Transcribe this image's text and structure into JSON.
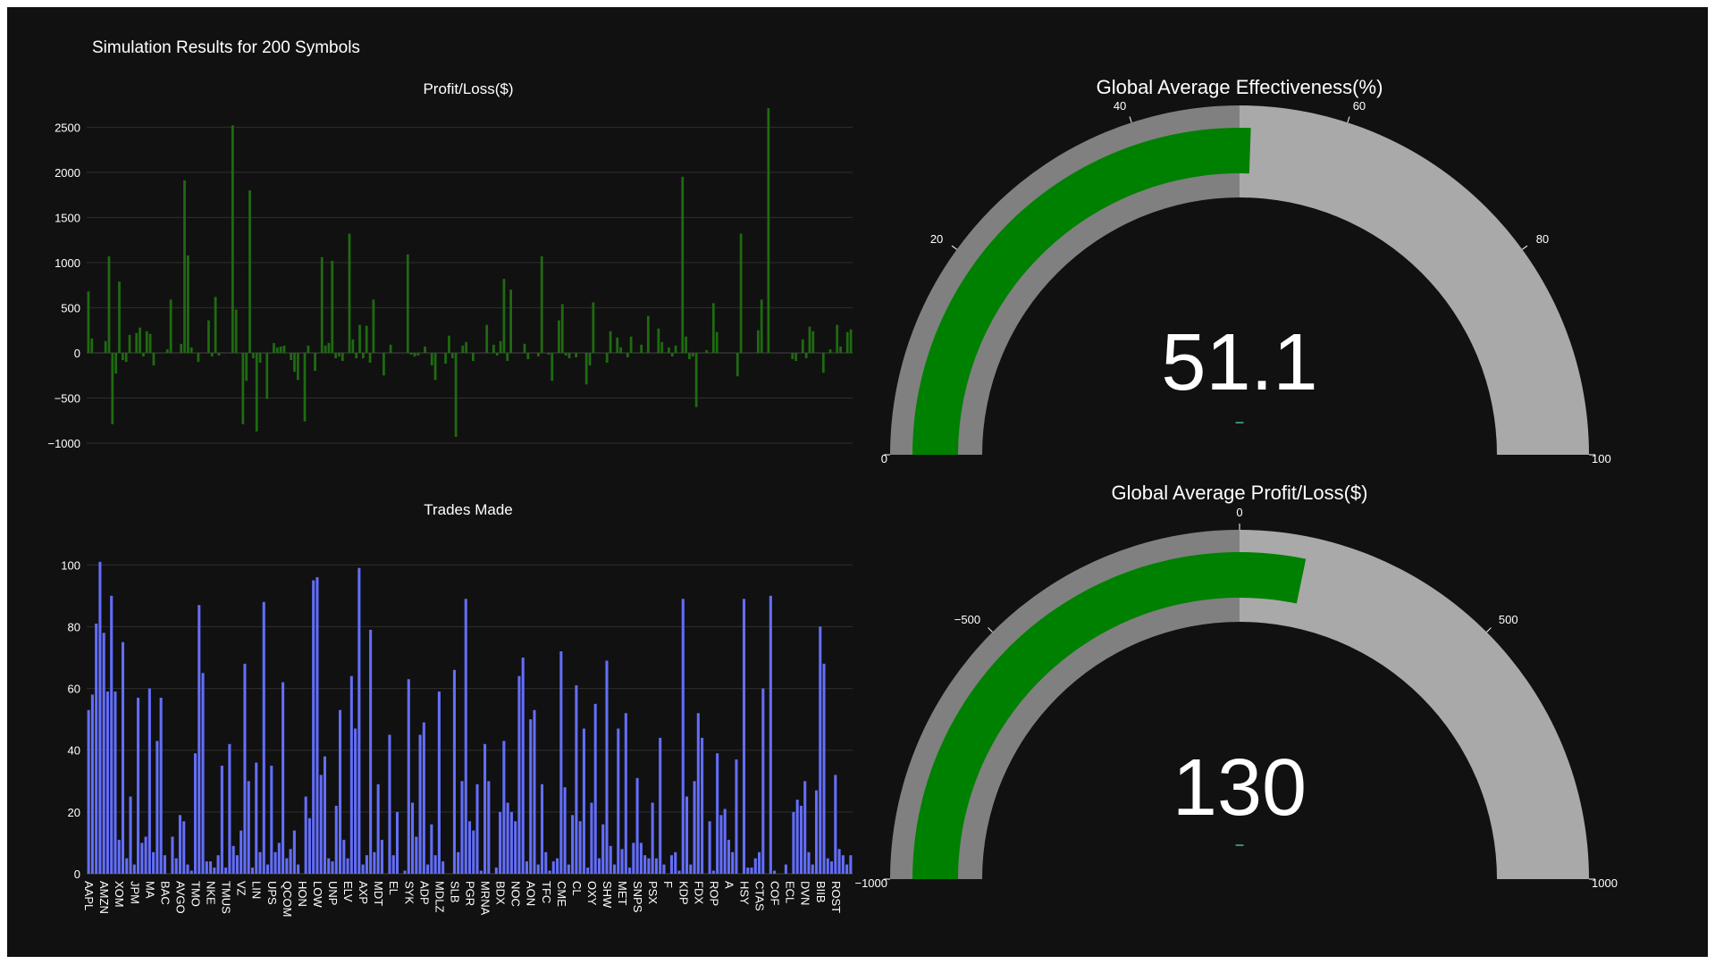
{
  "page": {
    "title": "Simulation Results for 200 Symbols"
  },
  "colors": {
    "background": "#111111",
    "profit_bar": "#1f6b10",
    "trades_bar": "#636efa",
    "gauge_bar": "#008000",
    "gauge_step_low": "#808080",
    "gauge_step_high": "#a9a9a9",
    "delta_decrease": "#3d9970"
  },
  "chart_data": [
    {
      "type": "bar",
      "title": "Profit/Loss($)",
      "ylim": [
        -1000,
        2800
      ],
      "yticks": [
        -1000,
        -500,
        0,
        500,
        1000,
        1500,
        2000,
        2500
      ],
      "grid": true,
      "values": [
        680,
        160,
        0,
        0,
        0,
        130,
        1070,
        -790,
        -230,
        790,
        -80,
        -100,
        200,
        0,
        220,
        280,
        -40,
        240,
        210,
        -140,
        0,
        0,
        0,
        40,
        590,
        0,
        0,
        100,
        1910,
        1080,
        60,
        0,
        -100,
        0,
        0,
        360,
        -40,
        620,
        -30,
        0,
        0,
        0,
        2520,
        480,
        0,
        -790,
        -310,
        1800,
        -60,
        -870,
        -110,
        0,
        -510,
        0,
        110,
        60,
        70,
        80,
        0,
        -80,
        -210,
        -300,
        0,
        -760,
        80,
        0,
        -200,
        0,
        1060,
        80,
        110,
        1020,
        -60,
        -40,
        -90,
        0,
        1320,
        150,
        -60,
        310,
        -60,
        300,
        -110,
        590,
        0,
        0,
        -250,
        0,
        90,
        0,
        0,
        0,
        0,
        1090,
        -20,
        -40,
        -30,
        0,
        70,
        0,
        -140,
        -300,
        0,
        0,
        -120,
        190,
        -60,
        -930,
        0,
        80,
        120,
        0,
        -90,
        0,
        0,
        0,
        310,
        0,
        90,
        -30,
        130,
        820,
        -90,
        700,
        0,
        0,
        0,
        100,
        -70,
        0,
        0,
        -40,
        1070,
        0,
        -20,
        -310,
        0,
        360,
        540,
        -30,
        -60,
        0,
        -50,
        0,
        0,
        -350,
        -140,
        560,
        0,
        0,
        0,
        -110,
        240,
        0,
        170,
        60,
        0,
        -50,
        180,
        0,
        0,
        90,
        0,
        410,
        0,
        0,
        270,
        120,
        0,
        60,
        -40,
        80,
        0,
        1950,
        180,
        -70,
        -40,
        -600,
        0,
        0,
        30,
        0,
        550,
        230,
        0,
        0,
        0,
        0,
        0,
        -260,
        1320,
        0,
        0,
        0,
        0,
        250,
        590,
        0,
        2710,
        0,
        0,
        0,
        0,
        0,
        0,
        -70,
        -90,
        0,
        150,
        -60,
        290,
        240,
        0,
        0,
        -220,
        0,
        40,
        0,
        310,
        70,
        0,
        230,
        260
      ],
      "bar_color": "#1f6b10"
    },
    {
      "type": "bar",
      "title": "Trades Made",
      "ylim": [
        0,
        105
      ],
      "yticks": [
        0,
        20,
        40,
        60,
        80,
        100
      ],
      "grid": true,
      "xtick_labels": [
        "AAPL",
        "AMZN",
        "XOM",
        "JPM",
        "MA",
        "BAC",
        "AVGO",
        "TMO",
        "NKE",
        "TMUS",
        "VZ",
        "LIN",
        "UPS",
        "QCOM",
        "HON",
        "LOW",
        "UNP",
        "ELV",
        "AXP",
        "MDT",
        "EL",
        "SYK",
        "ADP",
        "MDLZ",
        "SLB",
        "PGR",
        "MRNA",
        "BDX",
        "NOC",
        "AON",
        "TFC",
        "CME",
        "CL",
        "OXY",
        "SHW",
        "MET",
        "SNPS",
        "PSX",
        "F",
        "KDP",
        "FDX",
        "ROP",
        "A",
        "HSY",
        "CTAS",
        "COF",
        "ECL",
        "DVN",
        "BIIB",
        "ROST"
      ],
      "values": [
        53,
        58,
        81,
        101,
        78,
        59,
        90,
        59,
        11,
        75,
        5,
        25,
        3,
        57,
        10,
        12,
        60,
        7,
        43,
        57,
        6,
        0,
        12,
        5,
        19,
        17,
        3,
        1,
        39,
        87,
        65,
        4,
        4,
        2,
        6,
        35,
        2,
        42,
        9,
        6,
        14,
        68,
        30,
        2,
        36,
        7,
        88,
        3,
        35,
        7,
        10,
        62,
        5,
        8,
        14,
        3,
        0,
        25,
        18,
        95,
        96,
        32,
        38,
        5,
        4,
        22,
        53,
        11,
        5,
        64,
        47,
        99,
        3,
        6,
        79,
        7,
        29,
        11,
        0,
        45,
        6,
        20,
        0,
        1,
        63,
        23,
        12,
        45,
        49,
        3,
        16,
        6,
        59,
        4,
        0,
        0,
        66,
        7,
        30,
        89,
        17,
        14,
        29,
        1,
        42,
        30,
        0,
        2,
        20,
        43,
        23,
        20,
        17,
        64,
        70,
        4,
        50,
        53,
        3,
        29,
        7,
        1,
        4,
        5,
        72,
        28,
        3,
        19,
        61,
        17,
        47,
        2,
        23,
        55,
        5,
        16,
        69,
        9,
        3,
        47,
        8,
        52,
        2,
        10,
        31,
        10,
        6,
        5,
        23,
        5,
        44,
        3,
        0,
        6,
        7,
        1,
        89,
        25,
        3,
        30,
        52,
        44,
        0,
        17,
        1,
        39,
        19,
        21,
        11,
        7,
        37,
        0,
        89,
        2,
        2,
        5,
        7,
        60,
        0,
        90,
        1,
        0,
        0,
        3,
        0,
        20,
        24,
        22,
        30,
        7,
        3,
        27,
        80,
        68,
        5,
        4,
        32,
        8,
        6,
        3,
        6
      ],
      "bar_color": "#636efa"
    },
    {
      "type": "gauge",
      "title": "Global Average Effectiveness(%)",
      "value": 51.1,
      "value_label": "51.1",
      "range": [
        0,
        100
      ],
      "ticks": [
        "0",
        "20",
        "40",
        "60",
        "80",
        "100"
      ],
      "steps": [
        [
          0,
          50
        ],
        [
          50,
          100
        ]
      ],
      "delta_label": "–"
    },
    {
      "type": "gauge",
      "title": "Global Average Profit/Loss($)",
      "value": 130,
      "value_label": "130",
      "range": [
        -1000,
        1000
      ],
      "ticks": [
        "−1000",
        "−500",
        "0",
        "500",
        "1000"
      ],
      "steps": [
        [
          -1000,
          0
        ],
        [
          0,
          1000
        ]
      ],
      "delta_label": "–"
    }
  ]
}
